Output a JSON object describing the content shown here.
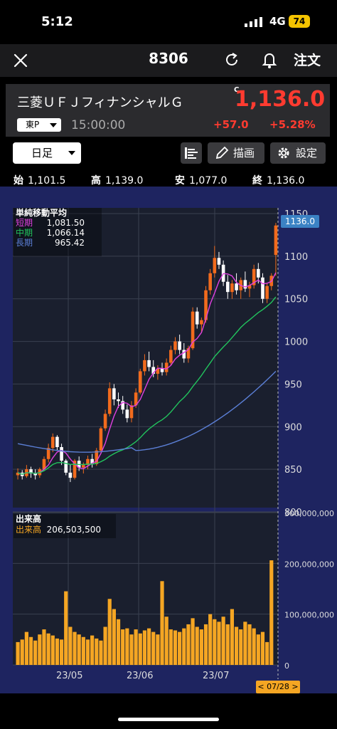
{
  "status": {
    "time": "5:12",
    "network": "4G",
    "battery": "74"
  },
  "nav": {
    "title": "8306",
    "order_label": "注文"
  },
  "stock": {
    "name": "三菱ＵＦＪフィナンシャルＧ",
    "c_mark": "C",
    "price": "1,136.0",
    "market": "東P",
    "time": "15:00:00",
    "change": "+57.0",
    "change_pct": "+5.28%",
    "up_color": "#ff3b30"
  },
  "toolbar": {
    "period": "日足",
    "draw_label": "描画",
    "settings_label": "設定"
  },
  "ohlc": {
    "open_label": "始",
    "open": "1,101.5",
    "high_label": "高",
    "high": "1,139.0",
    "low_label": "安",
    "low": "1,077.0",
    "close_label": "終",
    "close": "1,136.0"
  },
  "legend": {
    "title": "単純移動平均",
    "short_label": "短期",
    "short_value": "1,081.50",
    "short_color": "#e040e0",
    "mid_label": "中期",
    "mid_value": "1,066.14",
    "mid_color": "#22c55e",
    "long_label": "長期",
    "long_value": "965.42",
    "long_color": "#5b7fd6"
  },
  "volume_legend": {
    "title": "出来高",
    "label": "出来高",
    "value": "206,503,500"
  },
  "chart_data": {
    "type": "candlestick",
    "price_axis": {
      "ticks": [
        "1150",
        "1100",
        "1050",
        "1000",
        "950",
        "900",
        "850",
        "800"
      ],
      "ylim": [
        800,
        1150
      ]
    },
    "volume_axis": {
      "ticks": [
        "300,000,000",
        "200,000,000",
        "100,000,000",
        "0"
      ],
      "ylim": [
        0,
        300000000
      ]
    },
    "x_ticks": [
      "23/05",
      "23/06",
      "23/07"
    ],
    "current_price_tag": "1136.0",
    "date_tag": "< 07/28 >",
    "candles": [
      {
        "o": 843,
        "h": 851,
        "l": 838,
        "c": 846
      },
      {
        "o": 846,
        "h": 849,
        "l": 838,
        "c": 842
      },
      {
        "o": 842,
        "h": 855,
        "l": 840,
        "c": 850
      },
      {
        "o": 850,
        "h": 853,
        "l": 840,
        "c": 845
      },
      {
        "o": 845,
        "h": 850,
        "l": 838,
        "c": 843
      },
      {
        "o": 843,
        "h": 852,
        "l": 840,
        "c": 850
      },
      {
        "o": 850,
        "h": 865,
        "l": 848,
        "c": 862
      },
      {
        "o": 862,
        "h": 880,
        "l": 858,
        "c": 875
      },
      {
        "o": 875,
        "h": 892,
        "l": 870,
        "c": 888
      },
      {
        "o": 888,
        "h": 890,
        "l": 872,
        "c": 876
      },
      {
        "o": 876,
        "h": 880,
        "l": 855,
        "c": 860
      },
      {
        "o": 860,
        "h": 862,
        "l": 843,
        "c": 846
      },
      {
        "o": 846,
        "h": 856,
        "l": 835,
        "c": 840
      },
      {
        "o": 840,
        "h": 862,
        "l": 838,
        "c": 860
      },
      {
        "o": 860,
        "h": 865,
        "l": 848,
        "c": 852
      },
      {
        "o": 852,
        "h": 858,
        "l": 845,
        "c": 855
      },
      {
        "o": 855,
        "h": 866,
        "l": 850,
        "c": 862
      },
      {
        "o": 862,
        "h": 868,
        "l": 852,
        "c": 856
      },
      {
        "o": 856,
        "h": 875,
        "l": 854,
        "c": 872
      },
      {
        "o": 872,
        "h": 900,
        "l": 870,
        "c": 898
      },
      {
        "o": 898,
        "h": 920,
        "l": 895,
        "c": 915
      },
      {
        "o": 915,
        "h": 952,
        "l": 912,
        "c": 945
      },
      {
        "o": 945,
        "h": 950,
        "l": 925,
        "c": 932
      },
      {
        "o": 932,
        "h": 940,
        "l": 922,
        "c": 930
      },
      {
        "o": 930,
        "h": 936,
        "l": 915,
        "c": 920
      },
      {
        "o": 920,
        "h": 926,
        "l": 905,
        "c": 910
      },
      {
        "o": 910,
        "h": 930,
        "l": 905,
        "c": 925
      },
      {
        "o": 925,
        "h": 945,
        "l": 922,
        "c": 940
      },
      {
        "o": 940,
        "h": 968,
        "l": 938,
        "c": 965
      },
      {
        "o": 965,
        "h": 985,
        "l": 960,
        "c": 978
      },
      {
        "o": 978,
        "h": 988,
        "l": 965,
        "c": 970
      },
      {
        "o": 970,
        "h": 978,
        "l": 958,
        "c": 962
      },
      {
        "o": 962,
        "h": 972,
        "l": 955,
        "c": 968
      },
      {
        "o": 968,
        "h": 975,
        "l": 960,
        "c": 964
      },
      {
        "o": 964,
        "h": 980,
        "l": 960,
        "c": 975
      },
      {
        "o": 975,
        "h": 995,
        "l": 972,
        "c": 990
      },
      {
        "o": 990,
        "h": 1005,
        "l": 985,
        "c": 1000
      },
      {
        "o": 1000,
        "h": 1008,
        "l": 985,
        "c": 990
      },
      {
        "o": 990,
        "h": 998,
        "l": 975,
        "c": 980
      },
      {
        "o": 980,
        "h": 995,
        "l": 975,
        "c": 992
      },
      {
        "o": 992,
        "h": 1040,
        "l": 990,
        "c": 1035
      },
      {
        "o": 1035,
        "h": 1040,
        "l": 1015,
        "c": 1020
      },
      {
        "o": 1020,
        "h": 1028,
        "l": 1010,
        "c": 1025
      },
      {
        "o": 1025,
        "h": 1065,
        "l": 1022,
        "c": 1060
      },
      {
        "o": 1060,
        "h": 1085,
        "l": 1055,
        "c": 1080
      },
      {
        "o": 1080,
        "h": 1112,
        "l": 1075,
        "c": 1098
      },
      {
        "o": 1098,
        "h": 1105,
        "l": 1085,
        "c": 1090
      },
      {
        "o": 1090,
        "h": 1095,
        "l": 1065,
        "c": 1070
      },
      {
        "o": 1070,
        "h": 1078,
        "l": 1050,
        "c": 1058
      },
      {
        "o": 1058,
        "h": 1072,
        "l": 1050,
        "c": 1068
      },
      {
        "o": 1068,
        "h": 1080,
        "l": 1055,
        "c": 1060
      },
      {
        "o": 1060,
        "h": 1075,
        "l": 1050,
        "c": 1072
      },
      {
        "o": 1072,
        "h": 1082,
        "l": 1058,
        "c": 1062
      },
      {
        "o": 1062,
        "h": 1070,
        "l": 1052,
        "c": 1066
      },
      {
        "o": 1066,
        "h": 1090,
        "l": 1062,
        "c": 1085
      },
      {
        "o": 1085,
        "h": 1092,
        "l": 1068,
        "c": 1075
      },
      {
        "o": 1075,
        "h": 1080,
        "l": 1045,
        "c": 1050
      },
      {
        "o": 1050,
        "h": 1068,
        "l": 1045,
        "c": 1065
      },
      {
        "o": 1065,
        "h": 1080,
        "l": 1060,
        "c": 1077
      },
      {
        "o": 1101.5,
        "h": 1139,
        "l": 1077,
        "c": 1136
      }
    ],
    "volumes": [
      45,
      50,
      65,
      55,
      48,
      60,
      70,
      62,
      58,
      52,
      50,
      145,
      75,
      65,
      60,
      55,
      50,
      58,
      52,
      48,
      75,
      130,
      110,
      90,
      70,
      72,
      60,
      70,
      62,
      68,
      72,
      65,
      60,
      165,
      95,
      70,
      68,
      65,
      72,
      80,
      92,
      75,
      70,
      80,
      100,
      90,
      85,
      95,
      80,
      110,
      75,
      70,
      85,
      80,
      72,
      60,
      65,
      45,
      206
    ]
  }
}
